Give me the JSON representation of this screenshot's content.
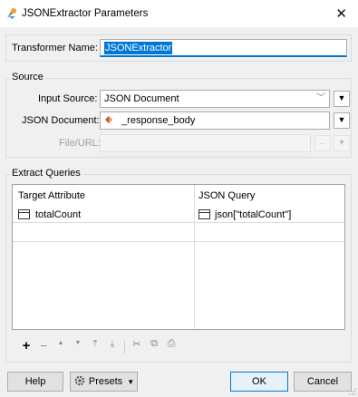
{
  "window": {
    "title": "JSONExtractor Parameters",
    "close_glyph": "✕"
  },
  "transformer_name": {
    "label": "Transformer Name:",
    "value": "JSONExtractor"
  },
  "source": {
    "legend": "Source",
    "input_source_label": "Input Source:",
    "input_source_value": "JSON Document",
    "json_document_label": "JSON Document:",
    "json_document_value": "_response_body",
    "file_url_label": "File/URL:",
    "file_url_value": "",
    "browse_label": "..."
  },
  "extract_queries": {
    "legend": "Extract Queries",
    "columns": [
      "Target Attribute",
      "JSON Query"
    ],
    "rows": [
      {
        "target": "totalCount",
        "query": "json[\"totalCount\"]"
      }
    ]
  },
  "toolbar": {
    "add": "+",
    "remove": "−",
    "up": "▲",
    "down": "▼",
    "top": "⤒",
    "bottom": "⤓",
    "cut": "✂",
    "copy": "⧉",
    "paste": "📋"
  },
  "footer": {
    "help": "Help",
    "presets": "Presets",
    "ok": "OK",
    "cancel": "Cancel"
  },
  "colors": {
    "accent": "#0078d7",
    "attribute_icon": "#c0504d"
  }
}
